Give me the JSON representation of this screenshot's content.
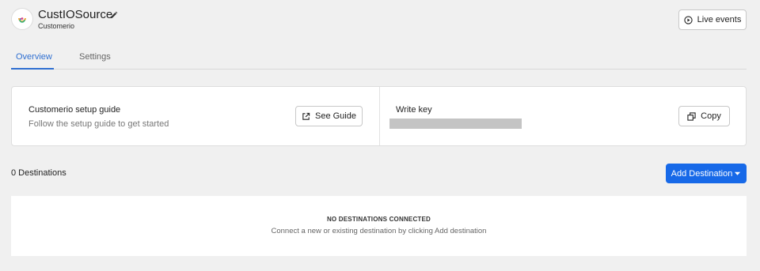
{
  "header": {
    "title": "CustIOSource",
    "subtitle": "Customerio",
    "logo_icon": "customerio-logo-icon",
    "edit_icon": "pencil-icon",
    "live_events_label": "Live events",
    "live_events_icon": "play-circle-icon"
  },
  "tabs": [
    {
      "label": "Overview",
      "active": true
    },
    {
      "label": "Settings",
      "active": false
    }
  ],
  "setup_card": {
    "guide_title": "Customerio setup guide",
    "guide_desc": "Follow the setup guide to get started",
    "guide_button": "See Guide",
    "guide_icon": "external-link-icon",
    "write_key_label": "Write key",
    "copy_button": "Copy",
    "copy_icon": "copy-icon"
  },
  "destinations": {
    "count_label": "0 Destinations",
    "add_button": "Add Destination",
    "add_icon": "caret-down-icon",
    "empty_title": "NO DESTINATIONS CONNECTED",
    "empty_desc": "Connect a new or existing destination by clicking Add destination"
  },
  "colors": {
    "accent": "#2f6fd1",
    "primary_button": "#1769e8",
    "page_bg": "#f0f0f0"
  }
}
